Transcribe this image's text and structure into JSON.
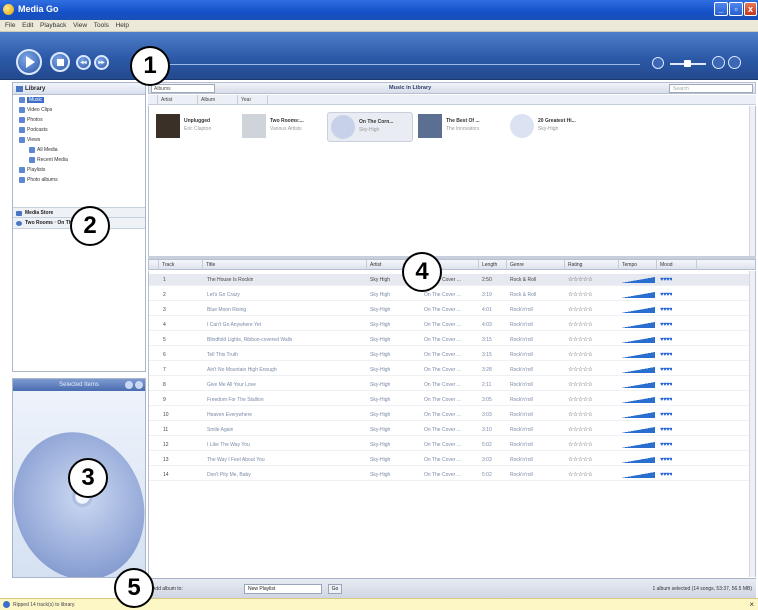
{
  "window": {
    "title": "Media Go",
    "min": "_",
    "max": "▫",
    "close": "x"
  },
  "menu": [
    "File",
    "Edit",
    "Playback",
    "View",
    "Tools",
    "Help"
  ],
  "player": {
    "prev": "◂◂",
    "next": "▸▸",
    "volume_level": 0.5
  },
  "nav": {
    "library_label": "Library",
    "items": [
      {
        "label": "Music",
        "selected": true
      },
      {
        "label": "Video Clips"
      },
      {
        "label": "Photos"
      },
      {
        "label": "Podcasts"
      },
      {
        "label": "Views"
      },
      {
        "label": "All Media"
      },
      {
        "label": "Recent Media"
      },
      {
        "label": "Playlists"
      },
      {
        "label": "Photo albums"
      }
    ],
    "section_store": "Media Store",
    "section_device": "Two Rooms · On The S..."
  },
  "selected_items": {
    "title": "Selected Items"
  },
  "library": {
    "view_select": "Albums",
    "center_title": "Music in Library",
    "search_placeholder": "Search",
    "album_columns": [
      "",
      "Artist",
      "Album",
      "Year"
    ],
    "albums": [
      {
        "t1": "Unplugged",
        "t2": "Eric Clapton",
        "color": "#3a3028",
        "selected": false
      },
      {
        "t1": "Two Rooms:...",
        "t2": "Various Artists",
        "color": "#cfd3da",
        "selected": false
      },
      {
        "t1": "On The Corn...",
        "t2": "Sky-High",
        "color": "#c7d2ea",
        "selected": true
      },
      {
        "t1": "The Best Of ...",
        "t2": "The Innovators",
        "color": "#5a6f92",
        "selected": false
      },
      {
        "t1": "20 Greatest Hi...",
        "t2": "Sky-High",
        "color": "#dbe3f2",
        "selected": false
      }
    ]
  },
  "tracks": {
    "columns": [
      "",
      "Track",
      "Title",
      "Artist",
      "Album",
      "Length",
      "Genre",
      "Rating",
      "Tempo",
      "Mood"
    ],
    "rows": [
      {
        "n": "1",
        "title": "The House Is Rockin",
        "artist": "Sky High",
        "album": "On The Cover ...",
        "len": "2:50",
        "genre": "Rock & Roll",
        "selected": true
      },
      {
        "n": "2",
        "title": "Let's Go Crazy",
        "artist": "Sky High",
        "album": "On The Cover ...",
        "len": "3:19",
        "genre": "Rock & Roll"
      },
      {
        "n": "3",
        "title": "Blue Moon Rising",
        "artist": "Sky-High",
        "album": "On The Cover ...",
        "len": "4:01",
        "genre": "Rock'n'roll"
      },
      {
        "n": "4",
        "title": "I Can't Go Anywhere Yet",
        "artist": "Sky-High",
        "album": "On The Cover ...",
        "len": "4:03",
        "genre": "Rock'n'roll"
      },
      {
        "n": "5",
        "title": "Blindfold Lights, Ribbon-covered Walls",
        "artist": "Sky-High",
        "album": "On The Cover ...",
        "len": "3:15",
        "genre": "Rock'n'roll"
      },
      {
        "n": "6",
        "title": "Tell This Truth",
        "artist": "Sky-High",
        "album": "On The Cover ...",
        "len": "3:15",
        "genre": "Rock'n'roll"
      },
      {
        "n": "7",
        "title": "Ain't No Mountain High Enough",
        "artist": "Sky-High",
        "album": "On The Cover ...",
        "len": "3:28",
        "genre": "Rock'n'roll"
      },
      {
        "n": "8",
        "title": "Give Me All Your Love",
        "artist": "Sky-High",
        "album": "On The Cover ...",
        "len": "2:11",
        "genre": "Rock'n'roll"
      },
      {
        "n": "9",
        "title": "Freedom For The Stallion",
        "artist": "Sky-High",
        "album": "On The Cover ...",
        "len": "3:05",
        "genre": "Rock'n'roll"
      },
      {
        "n": "10",
        "title": "Heaven Everywhere",
        "artist": "Sky-High",
        "album": "On The Cover ...",
        "len": "3:03",
        "genre": "Rock'n'roll"
      },
      {
        "n": "11",
        "title": "Smile Again",
        "artist": "Sky-High",
        "album": "On The Cover ...",
        "len": "3:10",
        "genre": "Rock'n'roll"
      },
      {
        "n": "12",
        "title": "I Like The Way You",
        "artist": "Sky-High",
        "album": "On The Cover ...",
        "len": "5:02",
        "genre": "Rock'n'roll"
      },
      {
        "n": "13",
        "title": "The Way I Feel About You",
        "artist": "Sky-High",
        "album": "On The Cover ...",
        "len": "3:03",
        "genre": "Rock'n'roll"
      },
      {
        "n": "14",
        "title": "Don't Pity Me, Baby",
        "artist": "Sky-High",
        "album": "On The Cover ...",
        "len": "5:02",
        "genre": "Rock'n'roll"
      }
    ],
    "stars": "☆☆☆☆☆",
    "mood": "♥♥♥♥"
  },
  "bottom": {
    "add_label": "Add album to:",
    "playlist_select": "New Playlist",
    "go": "Go",
    "info": "1 album selected (14 songs, 53:37, 56.5 MB)"
  },
  "status": {
    "message": "Ripped 14 track(s) to library.",
    "close": "×"
  },
  "callouts": [
    "1",
    "2",
    "3",
    "4",
    "5"
  ]
}
